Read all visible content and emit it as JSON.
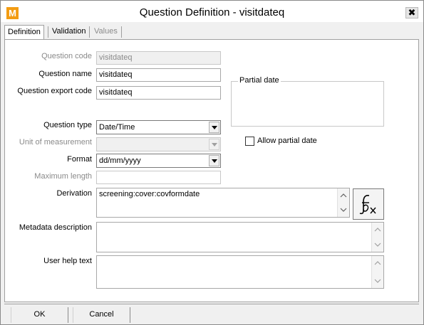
{
  "window": {
    "title": "Question Definition - visitdateq",
    "app_icon_letter": "M",
    "close_glyph": "✖"
  },
  "tabs": [
    {
      "label": "Definition",
      "state": "active"
    },
    {
      "label": "Validation",
      "state": "normal"
    },
    {
      "label": "Values",
      "state": "disabled"
    }
  ],
  "form": {
    "question_code": {
      "label": "Question code",
      "value": "visitdateq"
    },
    "question_name": {
      "label": "Question name",
      "value": "visitdateq"
    },
    "question_export_code": {
      "label": "Question export code",
      "value": "visitdateq"
    },
    "question_type": {
      "label": "Question type",
      "value": "Date/Time"
    },
    "unit_of_measurement": {
      "label": "Unit of measurement",
      "value": ""
    },
    "format": {
      "label": "Format",
      "value": "dd/mm/yyyy"
    },
    "maximum_length": {
      "label": "Maximum length",
      "value": ""
    },
    "derivation": {
      "label": "Derivation",
      "value": "screening:cover:covformdate"
    },
    "metadata_description": {
      "label": "Metadata description",
      "value": ""
    },
    "user_help_text": {
      "label": "User help text",
      "value": ""
    }
  },
  "partial_date": {
    "legend": "Partial date",
    "checkbox_label": "Allow partial date",
    "checked": false
  },
  "buttons": {
    "ok": "OK",
    "cancel": "Cancel"
  },
  "colors": {
    "app_icon": "#f39c12",
    "window_bg": "#f0f0f0",
    "panel_bg": "#ffffff"
  }
}
